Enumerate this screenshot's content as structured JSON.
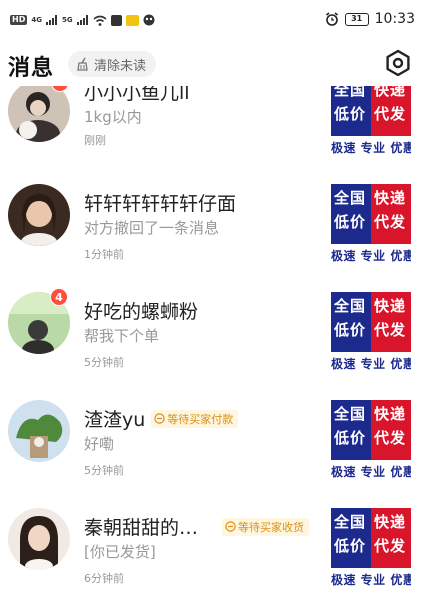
{
  "status_bar": {
    "left_icons": [
      "hd-icon",
      "signal-4g-icon",
      "signal-5g-icon",
      "wifi-icon",
      "upload-icon",
      "app-notification-icon",
      "app-notification-icon-2"
    ],
    "hd_label": "HD",
    "net1_label": "4G",
    "net2_label": "5G",
    "battery": "31",
    "time": "10:33"
  },
  "header": {
    "title": "消息",
    "clear_unread_label": "清除未读",
    "settings_icon": "settings-hexagon-icon"
  },
  "colors": {
    "badge": "#ff4d3a",
    "tag_text": "#d8901a",
    "tag_bg": "#fff6e0",
    "thumb_blue": "#1c2a8e",
    "thumb_red": "#d8152a"
  },
  "product_thumb": {
    "left_top": "全国",
    "left_bottom": "低价",
    "right_top": "快递",
    "right_bottom": "代发",
    "tagline": "极速 专业 优惠"
  },
  "conversations": [
    {
      "name": "小小小鱼儿ll",
      "preview": "1kg以内",
      "time": "刚刚",
      "badge": "",
      "status_tag": ""
    },
    {
      "name": "轩轩轩轩轩轩仔面",
      "preview": "对方撤回了一条消息",
      "time": "1分钟前",
      "badge": "",
      "status_tag": ""
    },
    {
      "name": "好吃的螺蛳粉",
      "preview": "帮我下个单",
      "time": "5分钟前",
      "badge": "4",
      "status_tag": ""
    },
    {
      "name": "渣渣yu",
      "preview": "好嘞",
      "time": "5分钟前",
      "badge": "",
      "status_tag": "等待买家付款"
    },
    {
      "name": "秦朝甜甜的…",
      "preview": "[你已发货]",
      "time": "6分钟前",
      "badge": "",
      "status_tag": "等待买家收货"
    }
  ]
}
